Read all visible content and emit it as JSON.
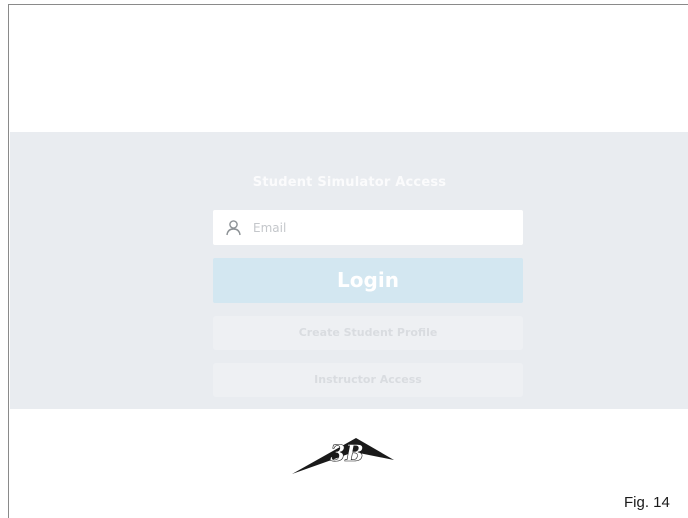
{
  "panel": {
    "title": "Student Simulator Access",
    "email": {
      "icon": "user-icon",
      "placeholder": "Email",
      "value": ""
    },
    "login_label": "Login",
    "create_profile_label": "Create Student Profile",
    "instructor_label": "Instructor Access"
  },
  "logo": {
    "icon": "3b-logo-icon",
    "text": "3B"
  },
  "caption": "Fig. 14",
  "colors": {
    "panel_background": "#e9ecf0",
    "login_button": "#d3e7f1",
    "secondary_button": "#eef0f3"
  }
}
